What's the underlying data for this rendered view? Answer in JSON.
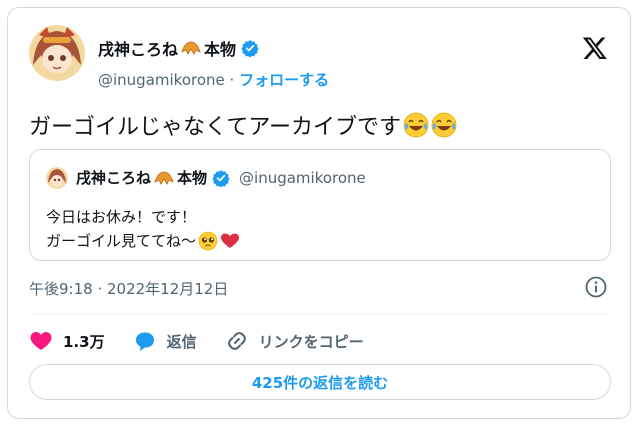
{
  "author": {
    "display_name": "戌神ころね",
    "name_suffix": "本物",
    "handle": "@inugamikorone",
    "separator": "·",
    "follow_label": "フォローする"
  },
  "tweet": {
    "text": "ガーゴイルじゃなくてアーカイブです",
    "emoji": [
      "face-with-tears-of-joy",
      "face-with-tears-of-joy"
    ],
    "timestamp": "午後9:18 · 2022年12月12日"
  },
  "quoted_tweet": {
    "display_name": "戌神ころね",
    "name_suffix": "本物",
    "handle": "@inugamikorone",
    "line1": "今日はお休み！です！",
    "line2": "ガーゴイル見ててね〜",
    "emoji": [
      "pleading-face",
      "heart"
    ]
  },
  "actions": {
    "like_count": "1.3万",
    "reply_label": "返信",
    "copy_link_label": "リンクをコピー"
  },
  "read_replies_label": "425件の返信を読む",
  "colors": {
    "accent": "#1d9bf0",
    "like": "#f91880",
    "text_primary": "#0f1419",
    "text_secondary": "#536471",
    "border": "#cfd9de"
  }
}
